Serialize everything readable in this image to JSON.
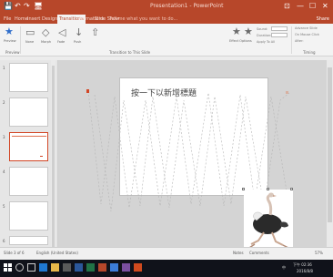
{
  "app": {
    "window_title": "Presentation1 - PowerPoint",
    "quick_access": {
      "save": "💾",
      "undo": "↶",
      "redo": "↷",
      "start": "🖥"
    },
    "window_controls": {
      "ribbon_options": "⊡",
      "minimize": "—",
      "maximize": "☐",
      "close": "✕"
    }
  },
  "tabs": [
    {
      "label": "File"
    },
    {
      "label": "Home"
    },
    {
      "label": "Insert"
    },
    {
      "label": "Design"
    },
    {
      "label": "Transitions"
    },
    {
      "label": "Animations"
    },
    {
      "label": "Slide Show"
    },
    {
      "label": "Review"
    },
    {
      "label": "View"
    }
  ],
  "active_tab_index": 4,
  "tell_me": "Tell me what you want to do...",
  "share": "Share",
  "ribbon": {
    "preview": "Preview",
    "effects": [
      "None",
      "Morph",
      "Fade",
      "Push"
    ],
    "effect_options": "Effect Options",
    "sound_label": "Sound:",
    "sound_value": "[No Sound]",
    "duration_label": "Duration:",
    "duration_value": "00.70",
    "apply_all": "Apply To All",
    "advance_label": "Advance Slide",
    "on_click": "On Mouse Click",
    "after": "After:",
    "groups": {
      "preview": "Preview",
      "transition": "Transition to This Slide",
      "timing": "Timing"
    }
  },
  "thumbnails": [
    {
      "num": "1"
    },
    {
      "num": "2"
    },
    {
      "num": "3"
    },
    {
      "num": "4"
    },
    {
      "num": "5"
    },
    {
      "num": "6"
    }
  ],
  "selected_thumbnail_index": 2,
  "slide": {
    "title": "按一下以新增標題"
  },
  "status": {
    "slide_info": "Slide 3 of 6",
    "language": "English (United States)",
    "notes": "Notes",
    "comments": "Comments",
    "zoom": "57%"
  },
  "taskbar": {
    "time": "下午 02:36",
    "date": "2016/8/8",
    "ime": "中"
  },
  "colors": {
    "accent": "#b7472a",
    "selected": "#d24726"
  }
}
